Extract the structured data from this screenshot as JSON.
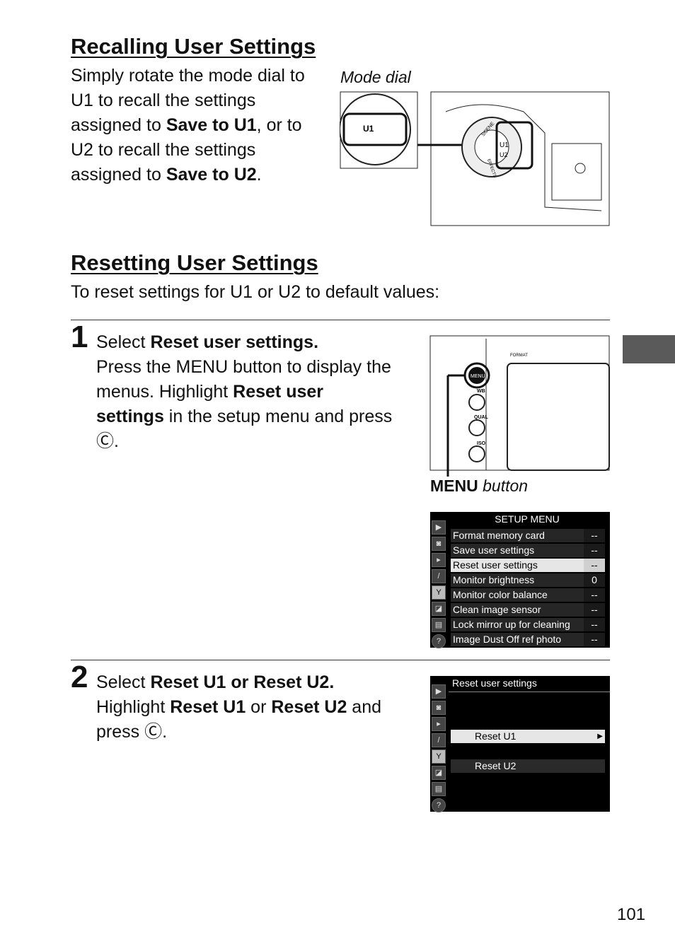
{
  "recall": {
    "heading": "Recalling User Settings",
    "lines": [
      {
        "pre": "Simply rotate the mode dial to",
        "bold": "",
        "post": ""
      },
      {
        "pre": "U1 to recall the settings",
        "bold": "",
        "post": ""
      },
      {
        "pre": "assigned to ",
        "bold": "Save to U1",
        "post": ", or to"
      },
      {
        "pre": "U2 to recall the settings",
        "bold": "",
        "post": ""
      },
      {
        "pre": "assigned to ",
        "bold": "Save to U2",
        "post": "."
      }
    ],
    "figure_caption": "Mode dial",
    "dial_labels": [
      "U1",
      "U2",
      "SCENE",
      "EFFECTS"
    ]
  },
  "reset": {
    "heading": "Resetting User Settings",
    "intro": "To reset settings for U1 or U2 to default values:"
  },
  "steps": [
    {
      "number": "1",
      "title_pre": "Select ",
      "title_bold": "Reset user settings.",
      "body": [
        {
          "pre": "Press the MENU button to display the",
          "bold": "",
          "post": ""
        },
        {
          "pre": "menus.  Highlight ",
          "bold": "Reset user",
          "post": ""
        },
        {
          "pre": "",
          "bold": "settings",
          "post": " in the setup menu and press"
        },
        {
          "pre": "Ⓒ.",
          "bold": "",
          "post": ""
        }
      ],
      "camera_caption_key": "MENU",
      "camera_caption": " button",
      "camera_labels": [
        "MENU",
        "WB",
        "QUAL",
        "ISO",
        "FORMAT"
      ],
      "screen": {
        "title": "SETUP MENU",
        "items": [
          {
            "label": "Format memory card",
            "value": "--"
          },
          {
            "label": "Save user settings",
            "value": "--"
          },
          {
            "label": "Reset user settings",
            "value": "--",
            "highlighted": true
          },
          {
            "label": "Monitor brightness",
            "value": "0"
          },
          {
            "label": "Monitor color balance",
            "value": "--"
          },
          {
            "label": "Clean image sensor",
            "value": "--"
          },
          {
            "label": "Lock mirror up for cleaning",
            "value": "--"
          },
          {
            "label": "Image Dust Off ref photo",
            "value": "--"
          }
        ]
      }
    },
    {
      "number": "2",
      "title_pre": "Select ",
      "title_bold": "Reset U1 or Reset U2.",
      "body": [
        {
          "pre": "Highlight ",
          "bold": "Reset U1",
          "post": " or "
        },
        {
          "pre": "press Ⓒ.",
          "bold": "",
          "post": ""
        }
      ],
      "body_line1_bold2": "Reset U2",
      "body_line1_post2": " and",
      "screen": {
        "title": "Reset user settings",
        "options": [
          "Reset U1",
          "Reset U2"
        ]
      }
    }
  ],
  "sidebar_icons": [
    "playback-icon",
    "camera-icon",
    "movie-icon",
    "pencil-icon",
    "wrench-icon",
    "retouch-icon",
    "my-menu-icon",
    "help-icon"
  ],
  "page_number": "101",
  "colors": {
    "tab": "#5a5a5a",
    "screen_bg": "#000000",
    "highlight": "#e6e6e6"
  }
}
